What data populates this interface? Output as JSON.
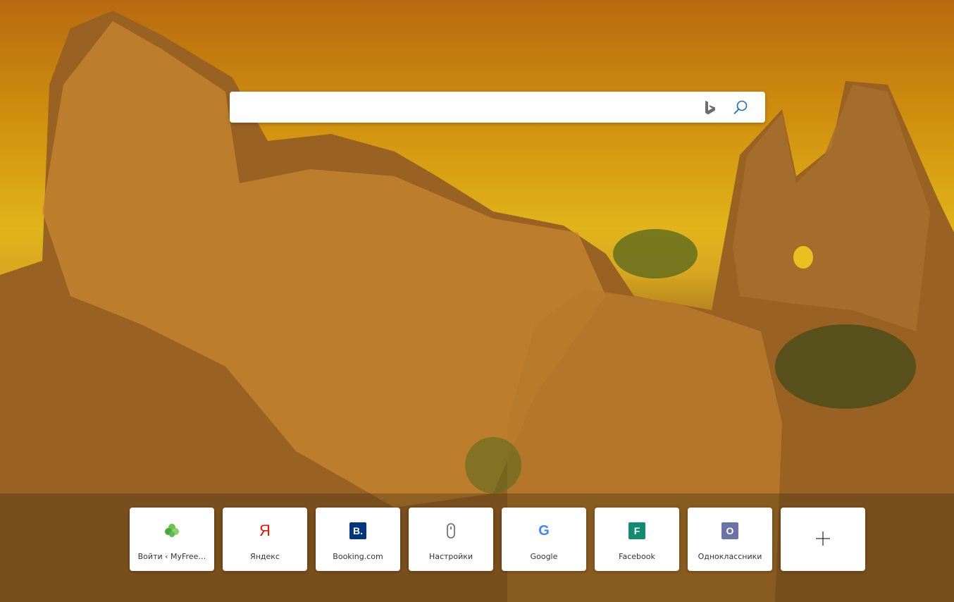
{
  "search": {
    "placeholder": "",
    "value": "",
    "engine_icon": "bing-logo-icon",
    "button_icon": "search-icon"
  },
  "tiles": [
    {
      "label": "Войти ‹ MyFree…",
      "icon": "clover-icon",
      "color": "#5cb85c"
    },
    {
      "label": "Яндекс",
      "icon_text": "Я",
      "color": "#e61400"
    },
    {
      "label": "Booking.com",
      "icon_text": "B.",
      "color": "#003580"
    },
    {
      "label": "Настройки",
      "icon": "mouse-icon",
      "color": "#666666"
    },
    {
      "label": "Google",
      "icon_text": "G",
      "color": "#4285f4"
    },
    {
      "label": "Facebook",
      "icon_text": "F",
      "color": "#138a72"
    },
    {
      "label": "Одноклассники",
      "icon_text": "O",
      "color": "#6b73a6"
    }
  ],
  "add_tile": {
    "icon": "plus-icon"
  }
}
